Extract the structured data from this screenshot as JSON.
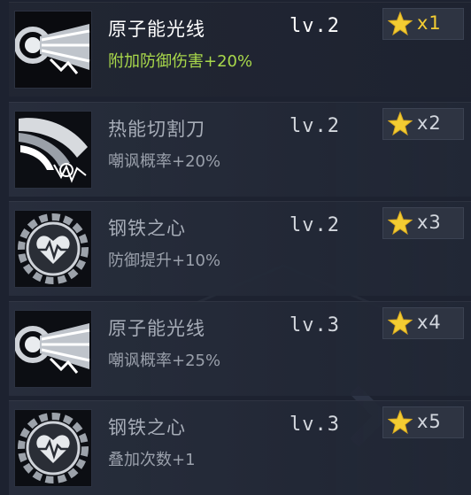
{
  "skills": [
    {
      "name": "原子能光线",
      "level": "lv.2",
      "effect": "附加防御伤害+20%",
      "count": "x1",
      "icon": "atomic-beam-icon",
      "active": true
    },
    {
      "name": "热能切割刀",
      "level": "lv.2",
      "effect": "嘲讽概率+20%",
      "count": "x2",
      "icon": "thermal-blade-icon",
      "active": false
    },
    {
      "name": "钢铁之心",
      "level": "lv.2",
      "effect": "防御提升+10%",
      "count": "x3",
      "icon": "steel-heart-icon",
      "active": false
    },
    {
      "name": "原子能光线",
      "level": "lv.3",
      "effect": "嘲讽概率+25%",
      "count": "x4",
      "icon": "atomic-beam-icon",
      "active": false
    },
    {
      "name": "钢铁之心",
      "level": "lv.3",
      "effect": "叠加次数+1",
      "count": "x5",
      "icon": "steel-heart-icon",
      "active": false
    }
  ],
  "colors": {
    "accent_green": "#a9d84b",
    "star_yellow": "#f3cc32",
    "row_bg": "#262c3a",
    "page_bg": "#1d2230"
  }
}
